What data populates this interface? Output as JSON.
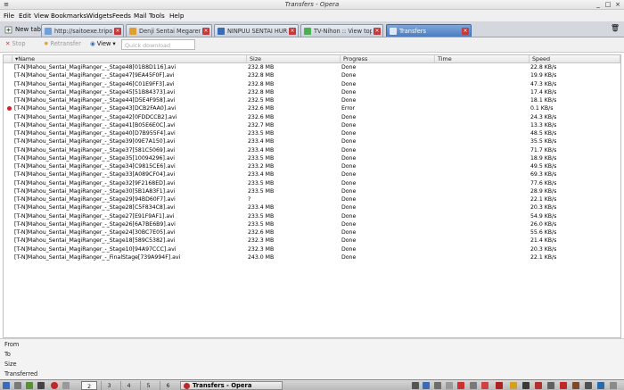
{
  "window": {
    "title": "Transfers - Opera"
  },
  "menu": [
    "File",
    "Edit",
    "View",
    "Bookmarks",
    "Widgets",
    "Feeds",
    "Mail",
    "Tools",
    "Help"
  ],
  "tabs": {
    "new_tab": "New tab",
    "items": [
      {
        "label": "http://saitoexe.tripod.co..."
      },
      {
        "label": "Denji Sentai Megarenj..."
      },
      {
        "label": "NINPUU SENTAI HUR..."
      },
      {
        "label": "TV-Nihon :: View topic ..."
      },
      {
        "label": "Transfers"
      }
    ]
  },
  "toolbar": {
    "stop": "Stop",
    "retransfer": "Retransfer",
    "view": "View",
    "quick_download_placeholder": "Quick download"
  },
  "columns": {
    "name": "Name",
    "size": "Size",
    "progress": "Progress",
    "time": "Time",
    "speed": "Speed"
  },
  "transfers": [
    {
      "name": "[T-N]Mahou_Sentai_MagiRanger_-_Stage48[01B8D116].avi",
      "size": "232.8 MB",
      "progress": "Done",
      "time": "",
      "speed": "22.8 KB/s",
      "error": false
    },
    {
      "name": "[T-N]Mahou_Sentai_MagiRanger_-_Stage47[9EA45F0F].avi",
      "size": "232.8 MB",
      "progress": "Done",
      "time": "",
      "speed": "19.9 KB/s",
      "error": false
    },
    {
      "name": "[T-N]Mahou_Sentai_MagiRanger_-_Stage46[C01E9FF3].avi",
      "size": "232.8 MB",
      "progress": "Done",
      "time": "",
      "speed": "47.3 KB/s",
      "error": false
    },
    {
      "name": "[T-N]Mahou_Sentai_MagiRanger_-_Stage45[51B84373].avi",
      "size": "232.8 MB",
      "progress": "Done",
      "time": "",
      "speed": "17.4 KB/s",
      "error": false
    },
    {
      "name": "[T-N]Mahou_Sentai_MagiRanger_-_Stage44[D5E4F958].avi",
      "size": "232.5 MB",
      "progress": "Done",
      "time": "",
      "speed": "18.1 KB/s",
      "error": false
    },
    {
      "name": "[T-N]Mahou_Sentai_MagiRanger_-_Stage43[DCB2FAA0].avi",
      "size": "232.6 MB",
      "progress": "Error",
      "time": "",
      "speed": "0.1 KB/s",
      "error": true
    },
    {
      "name": "[T-N]Mahou_Sentai_MagiRanger_-_Stage42[0FDDCCB2].avi",
      "size": "232.6 MB",
      "progress": "Done",
      "time": "",
      "speed": "24.3 KB/s",
      "error": false
    },
    {
      "name": "[T-N]Mahou_Sentai_MagiRanger_-_Stage41[B05E6E0C].avi",
      "size": "232.7 MB",
      "progress": "Done",
      "time": "",
      "speed": "13.3 KB/s",
      "error": false
    },
    {
      "name": "[T-N]Mahou_Sentai_MagiRanger_-_Stage40[D7B955F4].avi",
      "size": "233.5 MB",
      "progress": "Done",
      "time": "",
      "speed": "48.5 KB/s",
      "error": false
    },
    {
      "name": "[T-N]Mahou_Sentai_MagiRanger_-_Stage39[09E7A150].avi",
      "size": "233.4 MB",
      "progress": "Done",
      "time": "",
      "speed": "35.5 KB/s",
      "error": false
    },
    {
      "name": "[T-N]Mahou_Sentai_MagiRanger_-_Stage37[581C5069].avi",
      "size": "233.4 MB",
      "progress": "Done",
      "time": "",
      "speed": "71.7 KB/s",
      "error": false
    },
    {
      "name": "[T-N]Mahou_Sentai_MagiRanger_-_Stage35[10094296].avi",
      "size": "233.5 MB",
      "progress": "Done",
      "time": "",
      "speed": "18.9 KB/s",
      "error": false
    },
    {
      "name": "[T-N]Mahou_Sentai_MagiRanger_-_Stage34[C9815CE6].avi",
      "size": "233.2 MB",
      "progress": "Done",
      "time": "",
      "speed": "49.5 KB/s",
      "error": false
    },
    {
      "name": "[T-N]Mahou_Sentai_MagiRanger_-_Stage33[A089CF04].avi",
      "size": "233.4 MB",
      "progress": "Done",
      "time": "",
      "speed": "69.3 KB/s",
      "error": false
    },
    {
      "name": "[T-N]Mahou_Sentai_MagiRanger_-_Stage32[9F2168ED].avi",
      "size": "233.5 MB",
      "progress": "Done",
      "time": "",
      "speed": "77.6 KB/s",
      "error": false
    },
    {
      "name": "[T-N]Mahou_Sentai_MagiRanger_-_Stage30[5B1A83F1].avi",
      "size": "233.5 MB",
      "progress": "Done",
      "time": "",
      "speed": "28.9 KB/s",
      "error": false
    },
    {
      "name": "[T-N]Mahou_Sentai_MagiRanger_-_Stage29[94BD60F7].avi",
      "size": "?",
      "progress": "Done",
      "time": "",
      "speed": "22.1 KB/s",
      "error": false
    },
    {
      "name": "[T-N]Mahou_Sentai_MagiRanger_-_Stage28[C5F834C8].avi",
      "size": "233.4 MB",
      "progress": "Done",
      "time": "",
      "speed": "20.3 KB/s",
      "error": false
    },
    {
      "name": "[T-N]Mahou_Sentai_MagiRanger_-_Stage27[E91F9AF1].avi",
      "size": "233.5 MB",
      "progress": "Done",
      "time": "",
      "speed": "54.9 KB/s",
      "error": false
    },
    {
      "name": "[T-N]Mahou_Sentai_MagiRanger_-_Stage26[6A7BE6B9].avi",
      "size": "233.5 MB",
      "progress": "Done",
      "time": "",
      "speed": "26.0 KB/s",
      "error": false
    },
    {
      "name": "[T-N]Mahou_Sentai_MagiRanger_-_Stage24[30BC7E05].avi",
      "size": "232.6 MB",
      "progress": "Done",
      "time": "",
      "speed": "55.6 KB/s",
      "error": false
    },
    {
      "name": "[T-N]Mahou_Sentai_MagiRanger_-_Stage18[589C5382].avi",
      "size": "232.3 MB",
      "progress": "Done",
      "time": "",
      "speed": "21.4 KB/s",
      "error": false
    },
    {
      "name": "[T-N]Mahou_Sentai_MagiRanger_-_Stage10[94A97CCC].avi",
      "size": "232.3 MB",
      "progress": "Done",
      "time": "",
      "speed": "20.3 KB/s",
      "error": false
    },
    {
      "name": "[T-N]Mahou_Sentai_MagiRanger_-_FinalStage[739A994F].avi",
      "size": "243.0 MB",
      "progress": "Done",
      "time": "",
      "speed": "22.1 KB/s",
      "error": false
    }
  ],
  "details": {
    "from": "From",
    "to": "To",
    "size": "Size",
    "transferred": "Transferred"
  },
  "taskbar": {
    "workspaces": [
      "2",
      "3",
      "4",
      "5",
      "6"
    ],
    "active_workspace": "2",
    "task_label": "Transfers - Opera"
  },
  "colors": {
    "active_tab": "#5a85c6",
    "error_dot": "#d42222",
    "tab_close": "#c43a3a"
  }
}
